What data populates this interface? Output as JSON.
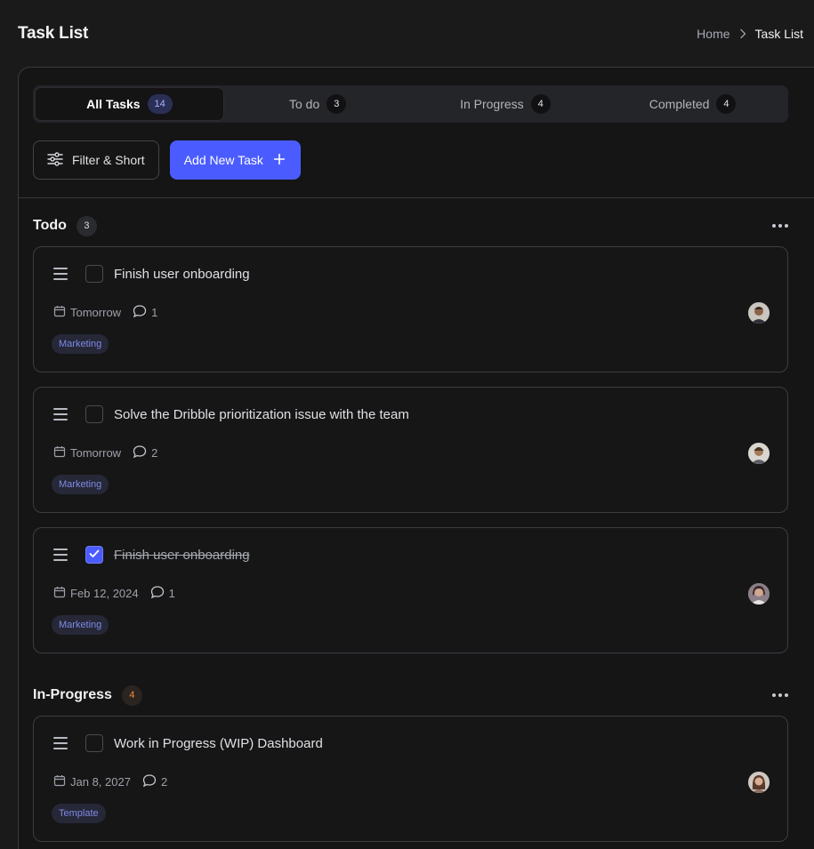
{
  "page": {
    "title": "Task List"
  },
  "breadcrumb": {
    "home": "Home",
    "current": "Task List"
  },
  "tabs": [
    {
      "label": "All Tasks",
      "count": "14",
      "active": true
    },
    {
      "label": "To do",
      "count": "3"
    },
    {
      "label": "In Progress",
      "count": "4"
    },
    {
      "label": "Completed",
      "count": "4"
    }
  ],
  "actions": {
    "filter_label": "Filter & Short",
    "add_label": "Add New Task"
  },
  "sections": [
    {
      "title": "Todo",
      "count": "3",
      "tasks": [
        {
          "title": "Finish user onboarding",
          "date": "Tomorrow",
          "comments": "1",
          "tag": "Marketing",
          "checked": false
        },
        {
          "title": "Solve the Dribble prioritization issue with the team",
          "date": "Tomorrow",
          "comments": "2",
          "tag": "Marketing",
          "checked": false
        },
        {
          "title": "Finish user onboarding",
          "date": "Feb 12, 2024",
          "comments": "1",
          "tag": "Marketing",
          "checked": true
        }
      ]
    },
    {
      "title": "In-Progress",
      "count": "4",
      "tasks": [
        {
          "title": "Work in Progress (WIP) Dashboard",
          "date": "Jan 8, 2027",
          "comments": "2",
          "tag": "Template",
          "checked": false
        }
      ]
    }
  ],
  "colors": {
    "accent": "#4a5cff",
    "tag_text": "#7f8ae6",
    "in_progress_count": "#f08a3c"
  },
  "icons": [
    "chevron-right-icon",
    "sliders-icon",
    "plus-icon",
    "more-icon",
    "drag-handle-icon",
    "calendar-icon",
    "comment-icon",
    "check-icon",
    "avatar"
  ]
}
